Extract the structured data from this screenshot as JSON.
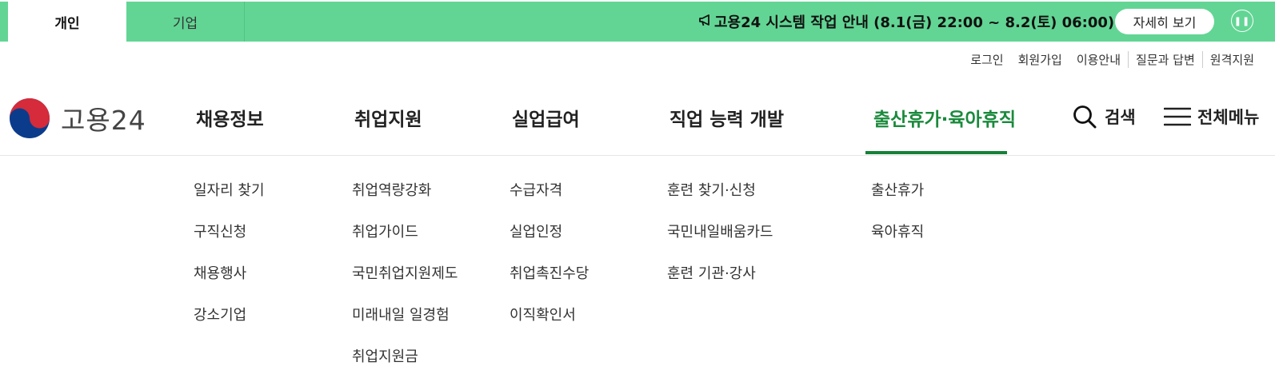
{
  "topbar": {
    "tabs": [
      {
        "label": "개인"
      },
      {
        "label": "기업"
      }
    ],
    "notice_icon": "megaphone-icon",
    "notice_text": "고용24 시스템 작업 안내 (8.1(금) 22:00 ~ 8.2(토) 06:00)",
    "detail_label": "자세히 보기",
    "pause_icon": "pause-icon",
    "color": "#62d594"
  },
  "utility": {
    "links": [
      "로그인",
      "회원가입",
      "이용안내",
      "질문과 답변",
      "원격지원"
    ]
  },
  "logo": {
    "text": "고용24"
  },
  "gnb": {
    "items": [
      "채용정보",
      "취업지원",
      "실업급여",
      "직업 능력 개발",
      "출산휴가·육아휴직"
    ],
    "active_index": 4,
    "active_color": "#1a8a3c"
  },
  "header": {
    "search_label": "검색",
    "search_icon": "search-icon",
    "menu_label": "전체메뉴",
    "menu_icon": "hamburger-menu-icon"
  },
  "submenu": {
    "col0": [
      "일자리 찾기",
      "구직신청",
      "채용행사",
      "강소기업"
    ],
    "col1": [
      "취업역량강화",
      "취업가이드",
      "국민취업지원제도",
      "미래내일 일경험",
      "취업지원금"
    ],
    "col2": [
      "수급자격",
      "실업인정",
      "취업촉진수당",
      "이직확인서"
    ],
    "col3": [
      "훈련 찾기·신청",
      "국민내일배움카드",
      "훈련 기관·강사"
    ],
    "col4": [
      "출산휴가",
      "육아휴직"
    ]
  }
}
